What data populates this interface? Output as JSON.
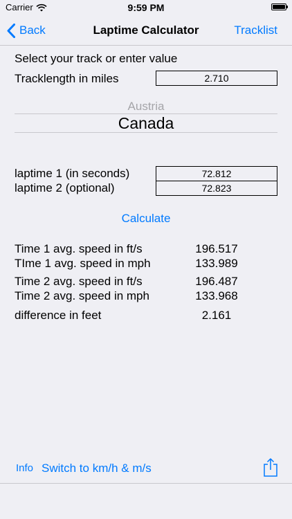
{
  "status_bar": {
    "carrier": "Carrier",
    "time": "9:59 PM"
  },
  "nav": {
    "back_label": "Back",
    "title": "Laptime Calculator",
    "right_label": "Tracklist"
  },
  "form": {
    "prompt": "Select your track or enter value",
    "track_length_label": "Tracklength in miles",
    "track_length_value": "2.710",
    "picker_prev": "Austria",
    "picker_selected": "Canada",
    "laptime1_label": "laptime 1 (in seconds)",
    "laptime1_value": "72.812",
    "laptime2_label": "laptime 2 (optional)",
    "laptime2_value": "72.823",
    "calculate_label": "Calculate"
  },
  "results": [
    {
      "label": "Time 1 avg. speed in ft/s",
      "value": "196.517"
    },
    {
      "label": "TIme 1 avg. speed in mph",
      "value": "133.989"
    },
    {
      "label": "Time 2 avg. speed in ft/s",
      "value": "196.487"
    },
    {
      "label": "Time 2 avg. speed in mph",
      "value": "133.968"
    },
    {
      "label": "difference in feet",
      "value": "2.161"
    }
  ],
  "toolbar": {
    "info_label": "Info",
    "switch_label": "Switch to km/h & m/s"
  },
  "colors": {
    "accent": "#007aff",
    "background": "#efeff4",
    "separator": "#c8c7cc"
  },
  "icons": {
    "back": "chevron-left-icon",
    "share": "share-icon",
    "wifi": "wifi-icon",
    "battery": "battery-icon"
  }
}
